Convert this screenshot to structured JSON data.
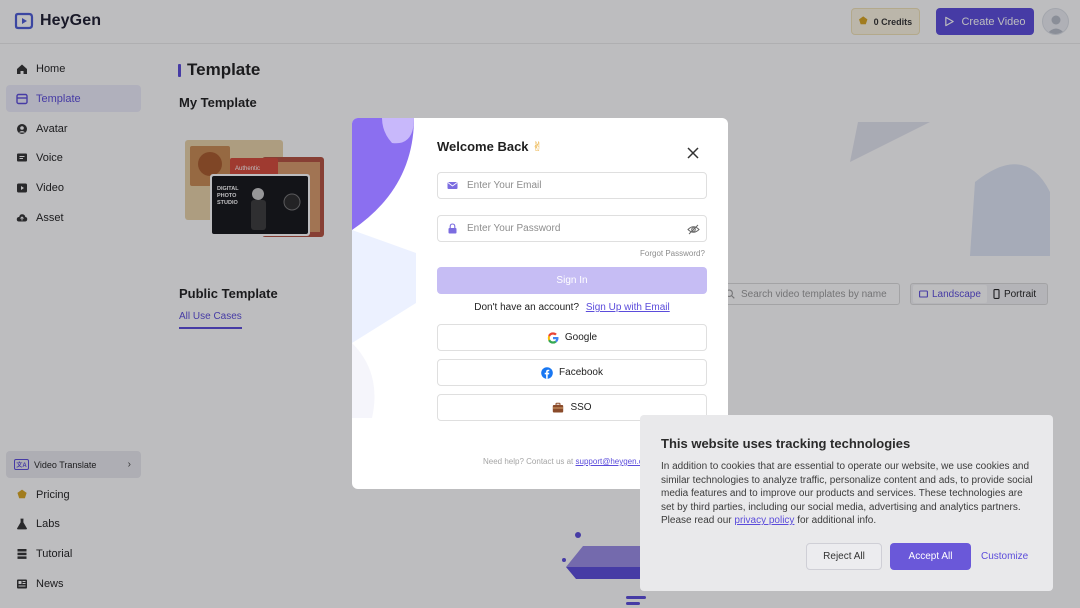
{
  "app": {
    "name": "HeyGen"
  },
  "header": {
    "credits_label": "0 Credits",
    "create_video_label": "Create Video"
  },
  "sidebar": {
    "items": [
      {
        "label": "Home",
        "icon": "home-icon"
      },
      {
        "label": "Template",
        "icon": "template-icon",
        "active": true
      },
      {
        "label": "Avatar",
        "icon": "avatar-icon"
      },
      {
        "label": "Voice",
        "icon": "voice-icon"
      },
      {
        "label": "Video",
        "icon": "video-icon"
      },
      {
        "label": "Asset",
        "icon": "asset-icon"
      }
    ],
    "video_translate": {
      "label": "Video Translate",
      "badge": "A"
    },
    "bottom_items": [
      {
        "label": "Pricing",
        "icon": "pricing-icon"
      },
      {
        "label": "Labs",
        "icon": "labs-icon"
      },
      {
        "label": "Tutorial",
        "icon": "tutorial-icon"
      },
      {
        "label": "News",
        "icon": "news-icon"
      }
    ]
  },
  "main": {
    "title": "Template",
    "my_template": "My Template",
    "public_template": "Public Template",
    "use_case_tab": "All Use Cases",
    "search_placeholder": "Search video templates by name",
    "orientation": {
      "landscape": "Landscape",
      "portrait": "Portrait",
      "selected": "Landscape"
    },
    "thumb_text": {
      "authentic": "Authentic",
      "digital": "DIGITAL PHOTO STUDIO"
    }
  },
  "login": {
    "title": "Welcome Back",
    "title_emoji": "✌",
    "email_placeholder": "Enter Your Email",
    "password_placeholder": "Enter Your Password",
    "forgot": "Forgot Password?",
    "signin": "Sign In",
    "no_account": "Don't have an account?",
    "signup_link": "Sign Up with Email",
    "google": "Google",
    "facebook": "Facebook",
    "sso": "SSO",
    "help_text": "Need help? Contact us at",
    "help_email": "support@heygen.com"
  },
  "cookie": {
    "title": "This website uses tracking technologies",
    "body_pre": "In addition to cookies that are essential to operate our website, we use cookies and similar technologies to analyze traffic, personalize content and ads, to provide social media features and to improve our products and services. These technologies are set by third parties, including our social media, advertising and analytics partners. Please read our",
    "privacy_link": "privacy policy",
    "body_post": "for additional info.",
    "reject": "Reject All",
    "accept": "Accept All",
    "customize": "Customize"
  },
  "colors": {
    "brand": "#5b4cdb",
    "signin_disabled": "#c6bdf4",
    "google_blue": "#4285F4",
    "facebook_blue": "#1877F2"
  }
}
